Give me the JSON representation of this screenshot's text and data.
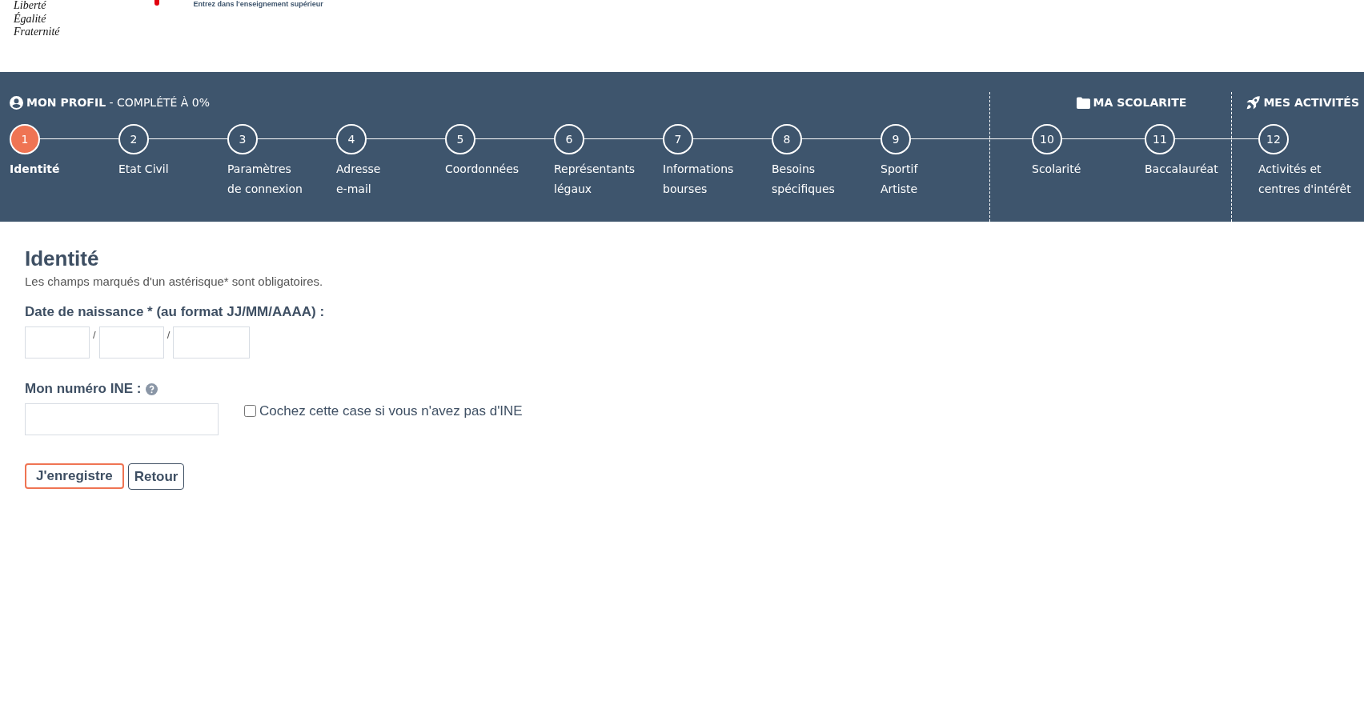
{
  "header": {
    "motto": [
      "Liberté",
      "Égalité",
      "Fraternité"
    ],
    "tagline": "Entrez dans l'enseignement supérieur"
  },
  "steps_band": {
    "groups": [
      {
        "kind": "profile",
        "title": "**MON PROFIL** - COMPLÉTÉ À 0%",
        "steps": [
          {
            "number": "1",
            "label": "Identité",
            "selected": true
          },
          {
            "number": "2",
            "label": "Etat Civil",
            "selected": false
          },
          {
            "number": "3",
            "label": "Paramètres\nde connexion",
            "selected": false
          },
          {
            "number": "4",
            "label": "Adresse\ne-mail",
            "selected": false
          },
          {
            "number": "5",
            "label": "Coordonnées",
            "selected": false
          },
          {
            "number": "6",
            "label": "Représentants\nlégaux",
            "selected": false
          },
          {
            "number": "7",
            "label": "Informations\nbourses",
            "selected": false
          },
          {
            "number": "8",
            "label": "Besoins\nspécifiques",
            "selected": false
          },
          {
            "number": "9",
            "label": "Sportif\nArtiste",
            "selected": false
          }
        ]
      },
      {
        "kind": "folder",
        "title": "MA SCOLARITE",
        "steps": [
          {
            "number": "10",
            "label": "Scolarité",
            "selected": false
          },
          {
            "number": "11",
            "label": "Baccalauréat",
            "selected": false
          }
        ]
      },
      {
        "kind": "rocket",
        "title": "MES ACTIVITÉS",
        "steps": [
          {
            "number": "12",
            "label": "Activités et\ncentres d'intérêt",
            "selected": false
          }
        ]
      }
    ]
  },
  "form": {
    "title": "Identité",
    "note": "Les champs marqués d'un astérisque* sont obligatoires.",
    "date_label": "Date de naissance * (au format JJ/MM/AAAA) :",
    "date_separators": [
      "/",
      "/"
    ],
    "ine_label": "Mon numéro INE :",
    "ine_checkbox": {
      "label": "Cochez cette case si vous n'avez pas d'INE",
      "checked": false
    },
    "buttons": [
      {
        "label": "J'enregistre",
        "kind": "primary"
      },
      {
        "label": "Retour",
        "kind": "secondary"
      }
    ]
  }
}
